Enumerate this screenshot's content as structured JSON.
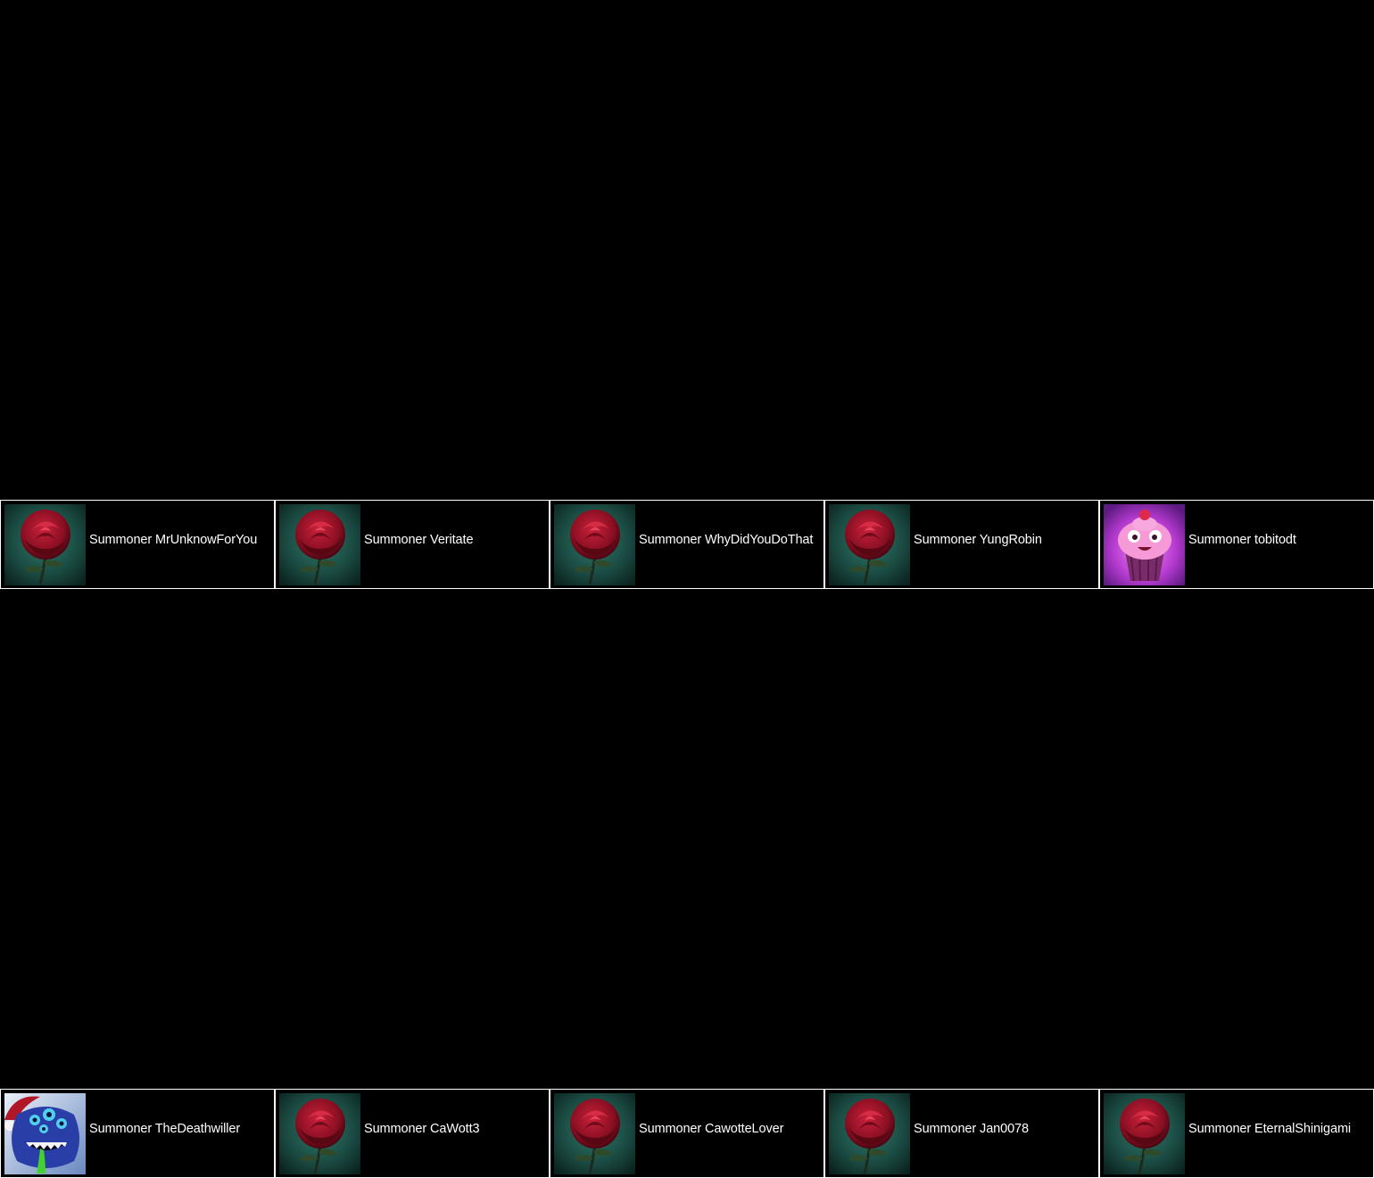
{
  "colors": {
    "background": "#000000",
    "card_border": "#ffffff",
    "text": "#ffffff"
  },
  "teams": {
    "top": {
      "players": [
        {
          "name": "Summoner MrUnknowForYou",
          "icon": "rose-icon"
        },
        {
          "name": "Summoner Veritate",
          "icon": "rose-icon"
        },
        {
          "name": "Summoner WhyDidYouDoThat",
          "icon": "rose-icon"
        },
        {
          "name": "Summoner YungRobin",
          "icon": "rose-icon"
        },
        {
          "name": "Summoner tobitodt",
          "icon": "cupcake-icon"
        }
      ]
    },
    "bottom": {
      "players": [
        {
          "name": "Summoner TheDeathwiller",
          "icon": "monster-icon"
        },
        {
          "name": "Summoner CaWott3",
          "icon": "rose-icon"
        },
        {
          "name": "Summoner CawotteLover",
          "icon": "rose-icon"
        },
        {
          "name": "Summoner Jan0078",
          "icon": "rose-icon"
        },
        {
          "name": "Summoner EternalShinigami",
          "icon": "rose-icon"
        }
      ]
    }
  }
}
